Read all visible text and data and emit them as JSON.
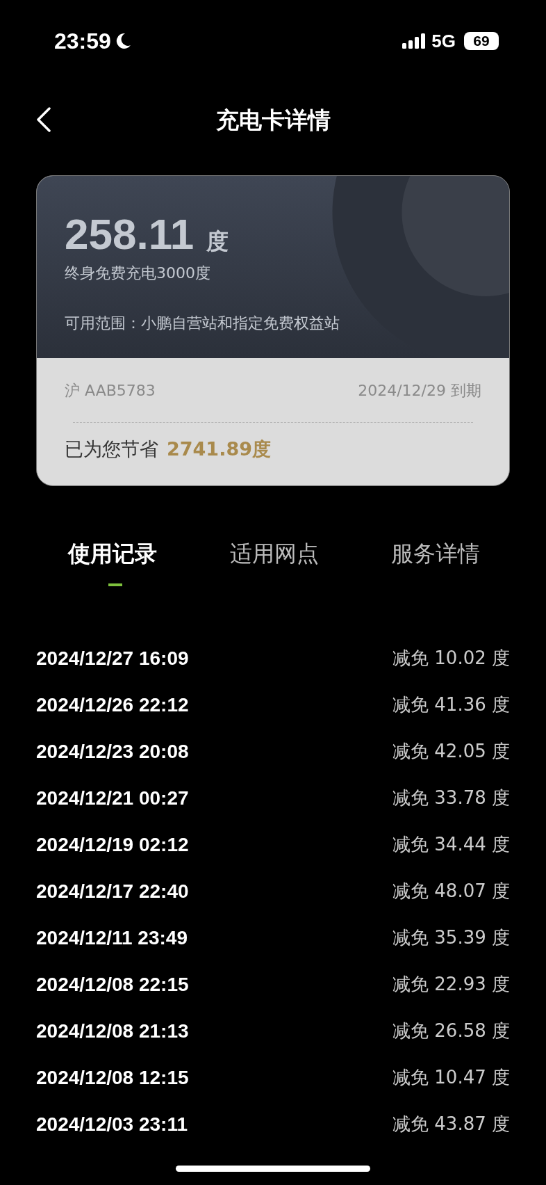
{
  "status_bar": {
    "time": "23:59",
    "network": "5G",
    "battery": "69"
  },
  "header": {
    "title": "充电卡详情"
  },
  "card": {
    "amount": "258.11",
    "unit": "度",
    "subtitle": "终身免费充电3000度",
    "scope": "可用范围：小鹏自营站和指定免费权益站",
    "plate": "沪 AAB5783",
    "expiry": "2024/12/29 到期",
    "saved_label": "已为您节省",
    "saved_value": "2741.89度"
  },
  "tabs": [
    {
      "label": "使用记录",
      "selected": true
    },
    {
      "label": "适用网点",
      "selected": false
    },
    {
      "label": "服务详情",
      "selected": false
    }
  ],
  "records": [
    {
      "time": "2024/12/27 16:09",
      "amount": "减免 10.02 度"
    },
    {
      "time": "2024/12/26 22:12",
      "amount": "减免 41.36 度"
    },
    {
      "time": "2024/12/23 20:08",
      "amount": "减免 42.05 度"
    },
    {
      "time": "2024/12/21 00:27",
      "amount": "减免 33.78 度"
    },
    {
      "time": "2024/12/19 02:12",
      "amount": "减免 34.44 度"
    },
    {
      "time": "2024/12/17 22:40",
      "amount": "减免 48.07 度"
    },
    {
      "time": "2024/12/11 23:49",
      "amount": "减免 35.39 度"
    },
    {
      "time": "2024/12/08 22:15",
      "amount": "减免 22.93 度"
    },
    {
      "time": "2024/12/08 21:13",
      "amount": "减免 26.58 度"
    },
    {
      "time": "2024/12/08 12:15",
      "amount": "减免 10.47 度"
    },
    {
      "time": "2024/12/03 23:11",
      "amount": "减免 43.87 度"
    }
  ]
}
